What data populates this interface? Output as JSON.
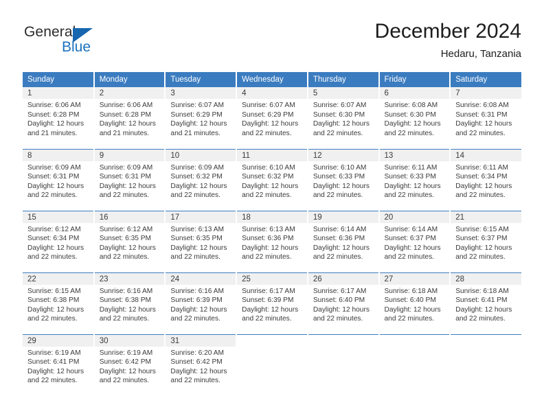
{
  "brand": {
    "name_part1": "General",
    "name_part2": "Blue",
    "triangle_color": "#1666b0",
    "blue_color": "#1a72bd"
  },
  "header": {
    "title": "December 2024",
    "subtitle": "Hedaru, Tanzania"
  },
  "theme": {
    "header_blue": "#3b7cc0",
    "daynum_band": "#f0f0f0",
    "text_color": "#3a3a3a"
  },
  "weekdays": [
    "Sunday",
    "Monday",
    "Tuesday",
    "Wednesday",
    "Thursday",
    "Friday",
    "Saturday"
  ],
  "weeks": [
    [
      {
        "day": "1",
        "sunrise": "Sunrise: 6:06 AM",
        "sunset": "Sunset: 6:28 PM",
        "daylight": "Daylight: 12 hours and 21 minutes."
      },
      {
        "day": "2",
        "sunrise": "Sunrise: 6:06 AM",
        "sunset": "Sunset: 6:28 PM",
        "daylight": "Daylight: 12 hours and 21 minutes."
      },
      {
        "day": "3",
        "sunrise": "Sunrise: 6:07 AM",
        "sunset": "Sunset: 6:29 PM",
        "daylight": "Daylight: 12 hours and 21 minutes."
      },
      {
        "day": "4",
        "sunrise": "Sunrise: 6:07 AM",
        "sunset": "Sunset: 6:29 PM",
        "daylight": "Daylight: 12 hours and 22 minutes."
      },
      {
        "day": "5",
        "sunrise": "Sunrise: 6:07 AM",
        "sunset": "Sunset: 6:30 PM",
        "daylight": "Daylight: 12 hours and 22 minutes."
      },
      {
        "day": "6",
        "sunrise": "Sunrise: 6:08 AM",
        "sunset": "Sunset: 6:30 PM",
        "daylight": "Daylight: 12 hours and 22 minutes."
      },
      {
        "day": "7",
        "sunrise": "Sunrise: 6:08 AM",
        "sunset": "Sunset: 6:31 PM",
        "daylight": "Daylight: 12 hours and 22 minutes."
      }
    ],
    [
      {
        "day": "8",
        "sunrise": "Sunrise: 6:09 AM",
        "sunset": "Sunset: 6:31 PM",
        "daylight": "Daylight: 12 hours and 22 minutes."
      },
      {
        "day": "9",
        "sunrise": "Sunrise: 6:09 AM",
        "sunset": "Sunset: 6:31 PM",
        "daylight": "Daylight: 12 hours and 22 minutes."
      },
      {
        "day": "10",
        "sunrise": "Sunrise: 6:09 AM",
        "sunset": "Sunset: 6:32 PM",
        "daylight": "Daylight: 12 hours and 22 minutes."
      },
      {
        "day": "11",
        "sunrise": "Sunrise: 6:10 AM",
        "sunset": "Sunset: 6:32 PM",
        "daylight": "Daylight: 12 hours and 22 minutes."
      },
      {
        "day": "12",
        "sunrise": "Sunrise: 6:10 AM",
        "sunset": "Sunset: 6:33 PM",
        "daylight": "Daylight: 12 hours and 22 minutes."
      },
      {
        "day": "13",
        "sunrise": "Sunrise: 6:11 AM",
        "sunset": "Sunset: 6:33 PM",
        "daylight": "Daylight: 12 hours and 22 minutes."
      },
      {
        "day": "14",
        "sunrise": "Sunrise: 6:11 AM",
        "sunset": "Sunset: 6:34 PM",
        "daylight": "Daylight: 12 hours and 22 minutes."
      }
    ],
    [
      {
        "day": "15",
        "sunrise": "Sunrise: 6:12 AM",
        "sunset": "Sunset: 6:34 PM",
        "daylight": "Daylight: 12 hours and 22 minutes."
      },
      {
        "day": "16",
        "sunrise": "Sunrise: 6:12 AM",
        "sunset": "Sunset: 6:35 PM",
        "daylight": "Daylight: 12 hours and 22 minutes."
      },
      {
        "day": "17",
        "sunrise": "Sunrise: 6:13 AM",
        "sunset": "Sunset: 6:35 PM",
        "daylight": "Daylight: 12 hours and 22 minutes."
      },
      {
        "day": "18",
        "sunrise": "Sunrise: 6:13 AM",
        "sunset": "Sunset: 6:36 PM",
        "daylight": "Daylight: 12 hours and 22 minutes."
      },
      {
        "day": "19",
        "sunrise": "Sunrise: 6:14 AM",
        "sunset": "Sunset: 6:36 PM",
        "daylight": "Daylight: 12 hours and 22 minutes."
      },
      {
        "day": "20",
        "sunrise": "Sunrise: 6:14 AM",
        "sunset": "Sunset: 6:37 PM",
        "daylight": "Daylight: 12 hours and 22 minutes."
      },
      {
        "day": "21",
        "sunrise": "Sunrise: 6:15 AM",
        "sunset": "Sunset: 6:37 PM",
        "daylight": "Daylight: 12 hours and 22 minutes."
      }
    ],
    [
      {
        "day": "22",
        "sunrise": "Sunrise: 6:15 AM",
        "sunset": "Sunset: 6:38 PM",
        "daylight": "Daylight: 12 hours and 22 minutes."
      },
      {
        "day": "23",
        "sunrise": "Sunrise: 6:16 AM",
        "sunset": "Sunset: 6:38 PM",
        "daylight": "Daylight: 12 hours and 22 minutes."
      },
      {
        "day": "24",
        "sunrise": "Sunrise: 6:16 AM",
        "sunset": "Sunset: 6:39 PM",
        "daylight": "Daylight: 12 hours and 22 minutes."
      },
      {
        "day": "25",
        "sunrise": "Sunrise: 6:17 AM",
        "sunset": "Sunset: 6:39 PM",
        "daylight": "Daylight: 12 hours and 22 minutes."
      },
      {
        "day": "26",
        "sunrise": "Sunrise: 6:17 AM",
        "sunset": "Sunset: 6:40 PM",
        "daylight": "Daylight: 12 hours and 22 minutes."
      },
      {
        "day": "27",
        "sunrise": "Sunrise: 6:18 AM",
        "sunset": "Sunset: 6:40 PM",
        "daylight": "Daylight: 12 hours and 22 minutes."
      },
      {
        "day": "28",
        "sunrise": "Sunrise: 6:18 AM",
        "sunset": "Sunset: 6:41 PM",
        "daylight": "Daylight: 12 hours and 22 minutes."
      }
    ],
    [
      {
        "day": "29",
        "sunrise": "Sunrise: 6:19 AM",
        "sunset": "Sunset: 6:41 PM",
        "daylight": "Daylight: 12 hours and 22 minutes."
      },
      {
        "day": "30",
        "sunrise": "Sunrise: 6:19 AM",
        "sunset": "Sunset: 6:42 PM",
        "daylight": "Daylight: 12 hours and 22 minutes."
      },
      {
        "day": "31",
        "sunrise": "Sunrise: 6:20 AM",
        "sunset": "Sunset: 6:42 PM",
        "daylight": "Daylight: 12 hours and 22 minutes."
      },
      {
        "day": "",
        "sunrise": "",
        "sunset": "",
        "daylight": ""
      },
      {
        "day": "",
        "sunrise": "",
        "sunset": "",
        "daylight": ""
      },
      {
        "day": "",
        "sunrise": "",
        "sunset": "",
        "daylight": ""
      },
      {
        "day": "",
        "sunrise": "",
        "sunset": "",
        "daylight": ""
      }
    ]
  ]
}
